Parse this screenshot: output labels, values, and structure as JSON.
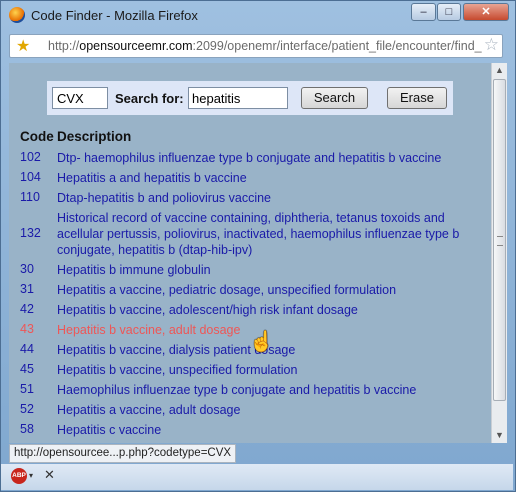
{
  "window": {
    "title": "Code Finder - Mozilla Firefox",
    "minimize_glyph": "–",
    "maximize_glyph": "□",
    "close_glyph": "✕"
  },
  "urlbar": {
    "url_prefix": "http://",
    "url_domain": "opensourceemr.com",
    "url_rest": ":2099/openemr/interface/patient_file/encounter/find_"
  },
  "search": {
    "code_type_value": "CVX",
    "label": "Search for:",
    "query_value": "hepatitis",
    "search_button": "Search",
    "erase_button": "Erase"
  },
  "table": {
    "headers": {
      "code": "Code",
      "description": "Description"
    },
    "rows": [
      {
        "code": "102",
        "description": "Dtp- haemophilus influenzae type b conjugate and hepatitis b vaccine"
      },
      {
        "code": "104",
        "description": "Hepatitis a and hepatitis b vaccine"
      },
      {
        "code": "110",
        "description": "Dtap-hepatitis b and poliovirus vaccine"
      },
      {
        "code": "132",
        "description": "Historical record of vaccine containing, diphtheria, tetanus toxoids and acellular pertussis, poliovirus, inactivated, haemophilus influenzae type b conjugate, hepatitis b (dtap-hib-ipv)"
      },
      {
        "code": "30",
        "description": "Hepatitis b immune globulin"
      },
      {
        "code": "31",
        "description": "Hepatitis a vaccine, pediatric dosage, unspecified formulation"
      },
      {
        "code": "42",
        "description": "Hepatitis b vaccine, adolescent/high risk infant dosage"
      },
      {
        "code": "43",
        "description": "Hepatitis b vaccine, adult dosage"
      },
      {
        "code": "44",
        "description": "Hepatitis b vaccine, dialysis patient dosage"
      },
      {
        "code": "45",
        "description": "Hepatitis b vaccine, unspecified formulation"
      },
      {
        "code": "51",
        "description": "Haemophilus influenzae type b conjugate and hepatitis b vaccine"
      },
      {
        "code": "52",
        "description": "Hepatitis a vaccine, adult dosage"
      },
      {
        "code": "58",
        "description": "Hepatitis c vaccine"
      }
    ],
    "hover_row": "43"
  },
  "statusbar": {
    "text": "http://opensourcee...p.php?codetype=CVX"
  },
  "addonbar": {
    "abp_label": "ABP",
    "dropdown_glyph": "▾",
    "close_glyph": "✕"
  },
  "colors": {
    "link": "#1a1aa8",
    "link_hover": "#ee5656",
    "content_bg": "#99b3c8",
    "search_bg": "#dde6f7"
  }
}
